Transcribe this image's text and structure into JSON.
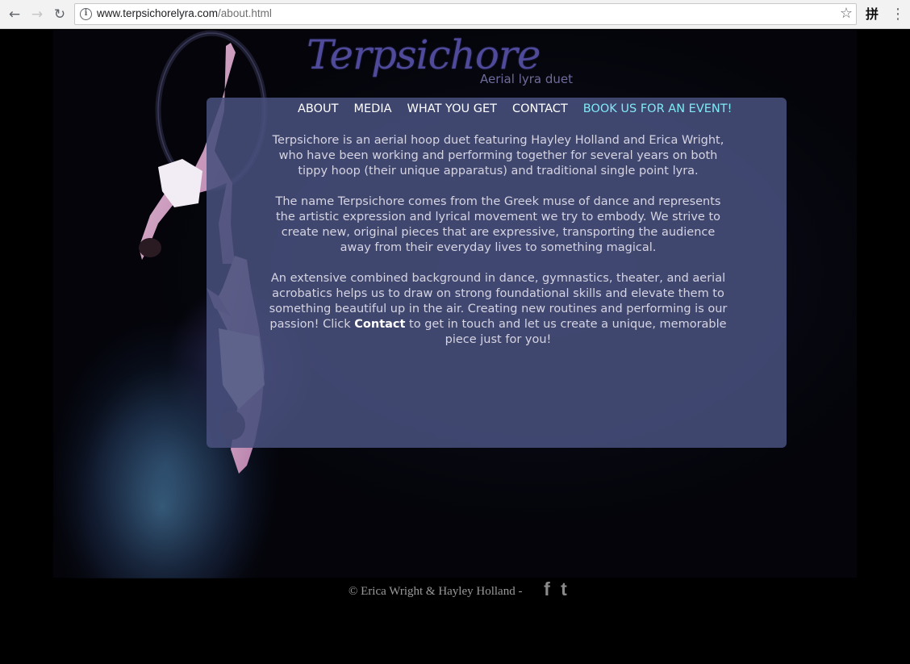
{
  "browser": {
    "url_host": "www.terpsichorelyra.com",
    "url_path": "/about.html",
    "back_icon": "←",
    "forward_icon": "→",
    "reload_icon": "↻",
    "star_icon": "☆",
    "ext_icon": "拼",
    "menu_icon": "⋮",
    "info_icon": "i"
  },
  "site": {
    "title": "Terpsichore",
    "subtitle": "Aerial lyra duet"
  },
  "nav": {
    "items": [
      {
        "label": "ABOUT"
      },
      {
        "label": "MEDIA"
      },
      {
        "label": "WHAT YOU GET"
      },
      {
        "label": "CONTACT"
      },
      {
        "label": "BOOK US FOR AN EVENT!"
      }
    ]
  },
  "about": {
    "p1": "Terpsichore is an aerial hoop duet featuring Hayley Holland and Erica Wright, who have been working and performing together for several years on both tippy hoop (their unique apparatus) and traditional single point lyra.",
    "p2": "The name Terpsichore comes from the Greek muse of dance and represents the artistic expression and lyrical movement we try to embody. We strive to create new, original pieces that are expressive, transporting the audience away from their everyday lives to something magical.",
    "p3_before": "An extensive combined background in dance, gymnastics, theater, and aerial acrobatics helps us to draw on strong foundational skills and elevate them to something beautiful up in the air. Creating new routines and performing is our passion! Click ",
    "p3_link": "Contact",
    "p3_after": " to get in touch and let us create a unique, memorable piece just for you!"
  },
  "footer": {
    "copyright": "© Erica Wright & Hayley Holland -",
    "facebook_glyph": "f",
    "twitter_glyph": "t"
  },
  "colors": {
    "nav_highlight": "#7fe9f5",
    "panel": "#48507c",
    "title": "#4f4a9a"
  }
}
